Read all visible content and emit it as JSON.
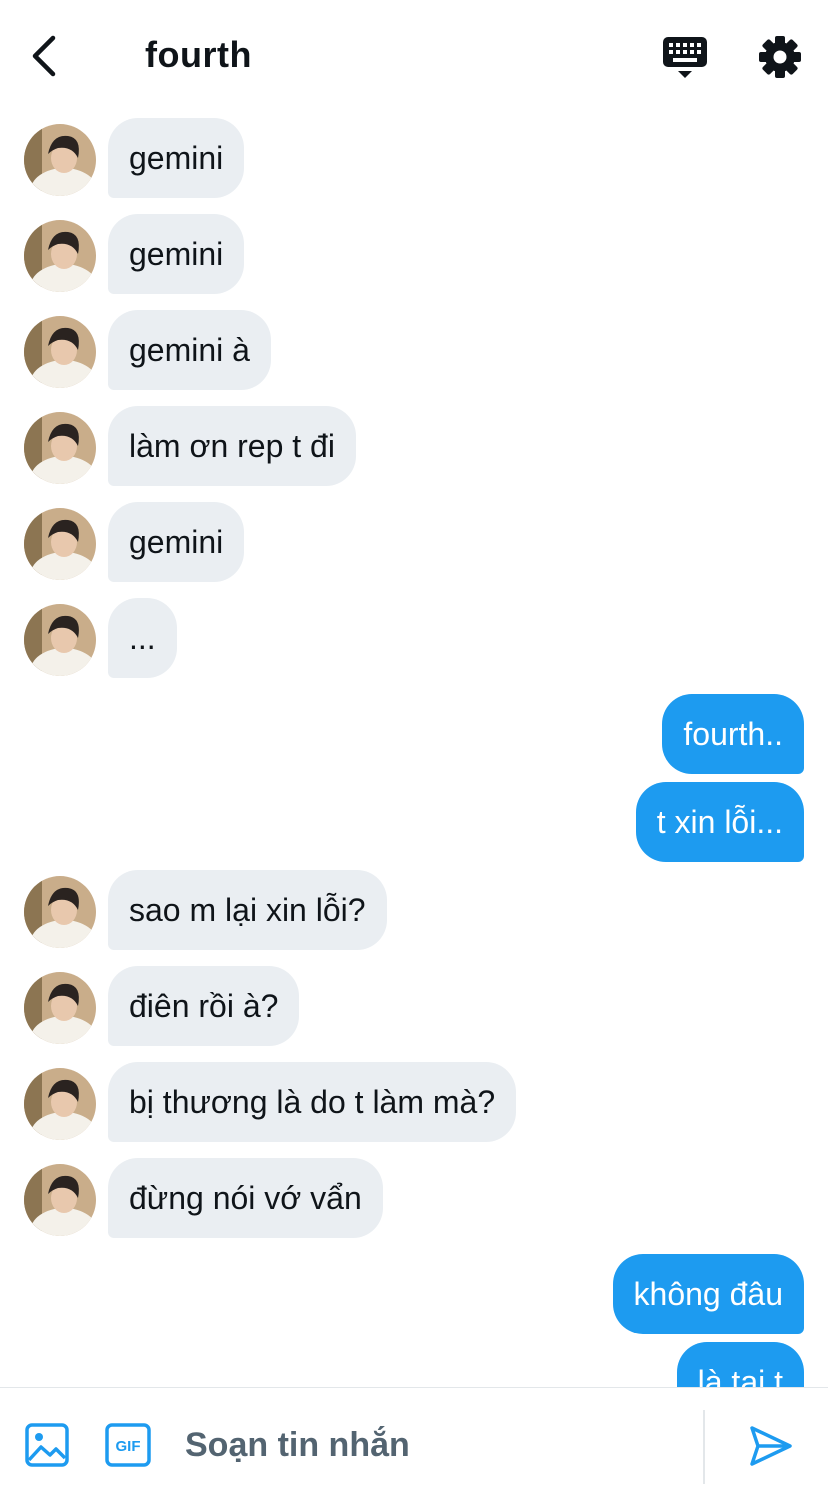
{
  "header": {
    "title": "fourth",
    "back_icon": "chevron-left-icon",
    "keyboard_icon": "keyboard-icon",
    "settings_icon": "gear-icon"
  },
  "colors": {
    "accent": "#1d9bf0",
    "incoming_bubble": "#eaeef2",
    "text_primary": "#0f1419",
    "text_secondary": "#536471"
  },
  "messages": [
    {
      "from": "them",
      "text": "gemini"
    },
    {
      "from": "them",
      "text": "gemini"
    },
    {
      "from": "them",
      "text": "gemini à"
    },
    {
      "from": "them",
      "text": "làm ơn rep t đi"
    },
    {
      "from": "them",
      "text": "gemini"
    },
    {
      "from": "them",
      "text": "..."
    },
    {
      "from": "me",
      "text": "fourth.."
    },
    {
      "from": "me",
      "text": "t xin lỗi..."
    },
    {
      "from": "them",
      "text": "sao m lại xin lỗi?"
    },
    {
      "from": "them",
      "text": "điên rồi à?"
    },
    {
      "from": "them",
      "text": "bị thương là do t làm mà?"
    },
    {
      "from": "them",
      "text": "đừng nói vớ vẩn"
    },
    {
      "from": "me",
      "text": "không đâu"
    },
    {
      "from": "me",
      "text": "là tại t"
    }
  ],
  "composer": {
    "placeholder": "Soạn tin nhắn",
    "image_icon": "image-icon",
    "gif_icon": "gif-icon",
    "gif_label": "GIF",
    "send_icon": "send-icon"
  }
}
